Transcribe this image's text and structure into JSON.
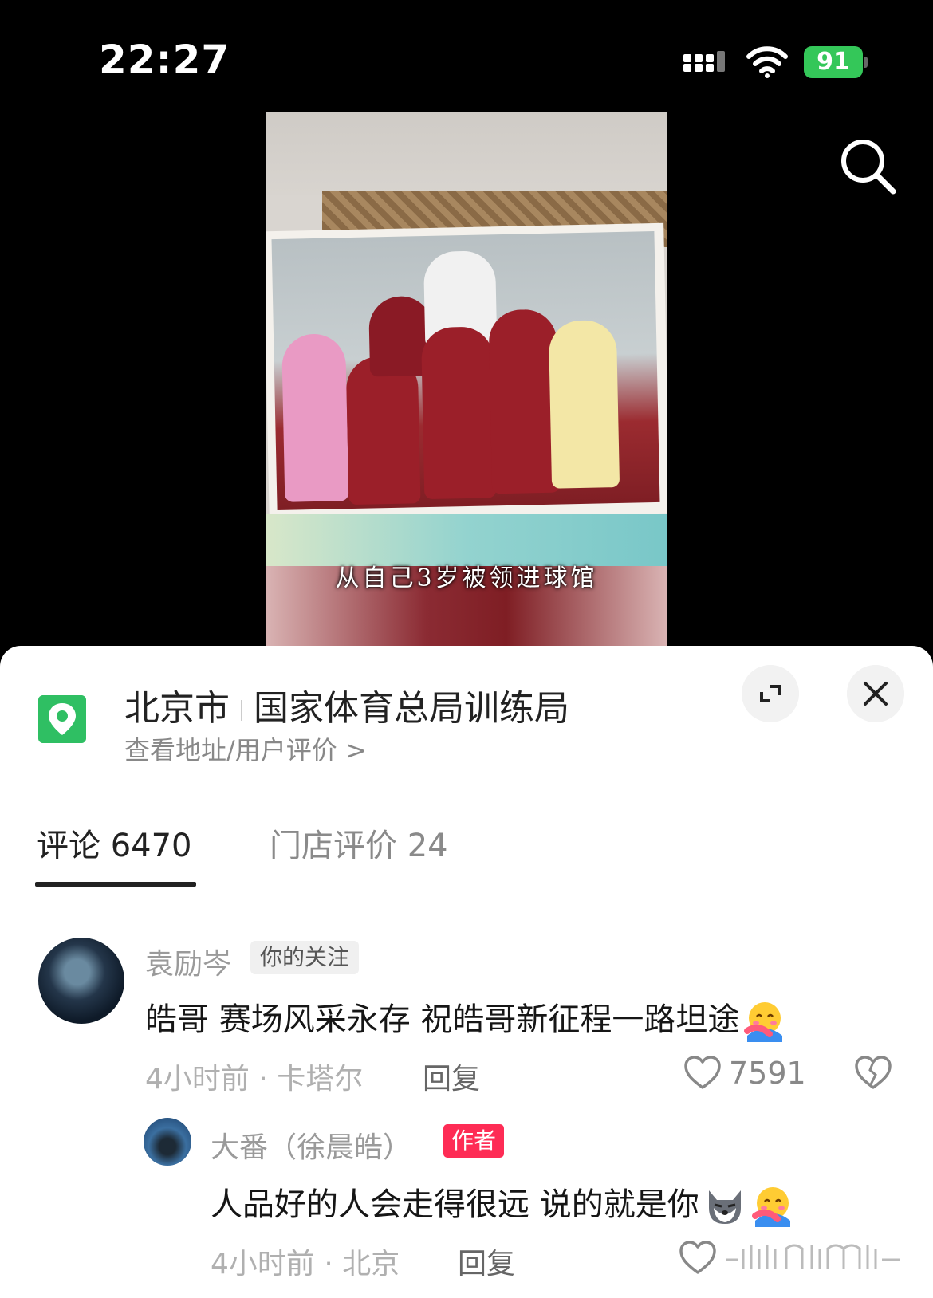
{
  "status_bar": {
    "time": "22:27",
    "battery": "91",
    "icons": [
      "signal-icon",
      "wifi-icon",
      "battery-icon"
    ]
  },
  "video": {
    "caption": "从自己3岁被领进球馆"
  },
  "location": {
    "city": "北京市",
    "place": "国家体育总局训练局",
    "sub_link": "查看地址/用户评价 >",
    "accent_color": "#2fbf63"
  },
  "tabs": [
    {
      "label": "评论 6470",
      "active": true
    },
    {
      "label": "门店评价 24",
      "active": false
    }
  ],
  "comments": [
    {
      "user": "袁励岑",
      "badge": "你的关注",
      "text": "皓哥 赛场风采永存 祝皓哥新征程一路坦途",
      "meta": "4小时前 · 卡塔尔",
      "reply_label": "回复",
      "likes": "7591"
    },
    {
      "user": "大番（徐晨皓）",
      "badge": "作者",
      "text": "人品好的人会走得很远 说的就是你",
      "meta": "4小时前 · 北京",
      "reply_label": "回复",
      "badge_color": "#fe2c55"
    }
  ]
}
